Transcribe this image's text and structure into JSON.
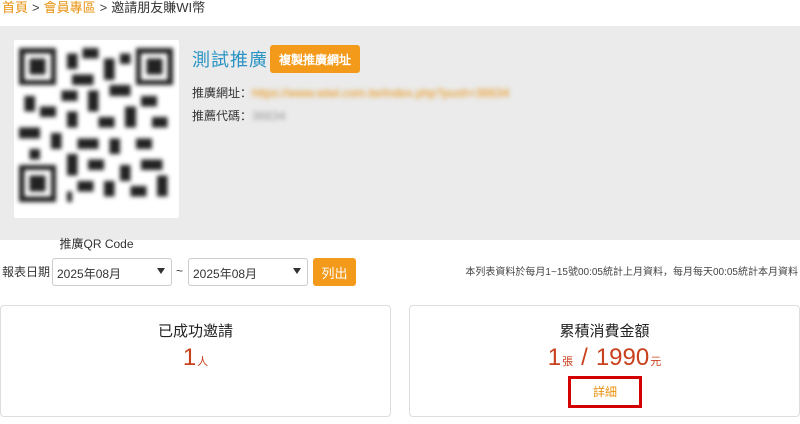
{
  "breadcrumb": {
    "home": "首頁",
    "member": "會員專區",
    "current": "邀請朋友賺WI幣",
    "separator": ">"
  },
  "promo": {
    "title": "測試推廣",
    "copy_button": "複製推廣網址",
    "url_label": "推廣網址：",
    "url_value": "https://www.wiwi.com.tw/index.php?push=36634",
    "code_label": "推薦代碼：",
    "code_value": "36634",
    "qr_label": "推廣QR Code"
  },
  "filter": {
    "label": "報表日期",
    "from": "2025年08月",
    "to": "2025年08月",
    "tilde": "~",
    "list_button": "列出",
    "note": "本列表資料於每月1~15號00:05統計上月資料，每月每天00:05統計本月資料"
  },
  "stats": {
    "invited": {
      "title": "已成功邀請",
      "count": "1",
      "unit": "人"
    },
    "spend": {
      "title": "累積消費金額",
      "count": "1",
      "count_unit": "張",
      "slash": "/",
      "amount": "1990",
      "amount_unit": "元",
      "detail": "詳細"
    }
  },
  "colors": {
    "accent": "#f39a1b",
    "link": "#e8900c",
    "title_blue": "#2a93c4",
    "value_red": "#c9401c",
    "highlight_border": "#d40000"
  }
}
